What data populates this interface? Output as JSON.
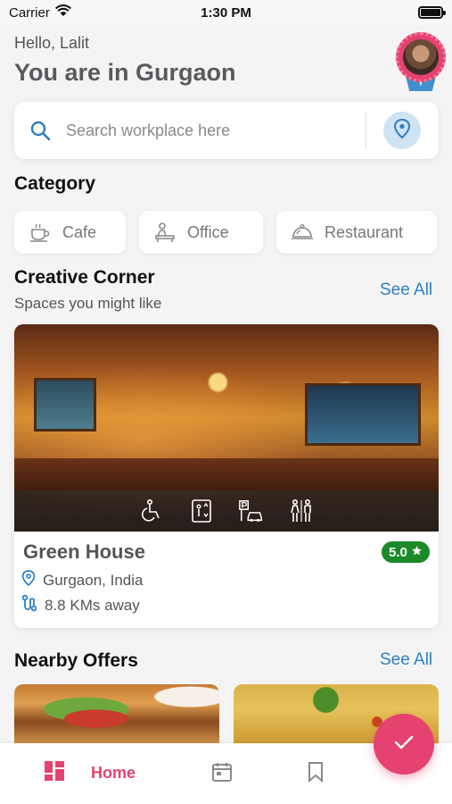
{
  "status_bar": {
    "carrier": "Carrier",
    "time": "1:30 PM"
  },
  "header": {
    "greeting": "Hello, Lalit",
    "location_title": "You are in Gurgaon"
  },
  "search": {
    "placeholder": "Search workplace here"
  },
  "category": {
    "title": "Category",
    "items": [
      {
        "label": "Cafe",
        "icon": "coffee-cup-icon"
      },
      {
        "label": "Office",
        "icon": "desk-worker-icon"
      },
      {
        "label": "Restaurant",
        "icon": "cloche-icon"
      }
    ]
  },
  "creative_corner": {
    "title": "Creative Corner",
    "subtitle": "Spaces you might like",
    "see_all": "See All",
    "place": {
      "name": "Green House",
      "rating": "5.0",
      "location": "Gurgaon, India",
      "distance": "8.8 KMs away",
      "amenities": [
        "wheelchair-icon",
        "elevator-icon",
        "parking-icon",
        "restroom-icon"
      ]
    }
  },
  "nearby_offers": {
    "title": "Nearby Offers",
    "see_all": "See All",
    "offers": [
      "burger-photo",
      "poha-photo"
    ]
  },
  "bottom_nav": {
    "items": [
      {
        "label": "Home",
        "icon": "grid-icon",
        "active": true
      },
      {
        "label": "",
        "icon": "calendar-icon",
        "active": false
      },
      {
        "label": "",
        "icon": "bookmark-icon",
        "active": false
      }
    ]
  },
  "colors": {
    "accent": "#e5426f",
    "link": "#2e7fc1",
    "rating": "#1c8a2b"
  }
}
